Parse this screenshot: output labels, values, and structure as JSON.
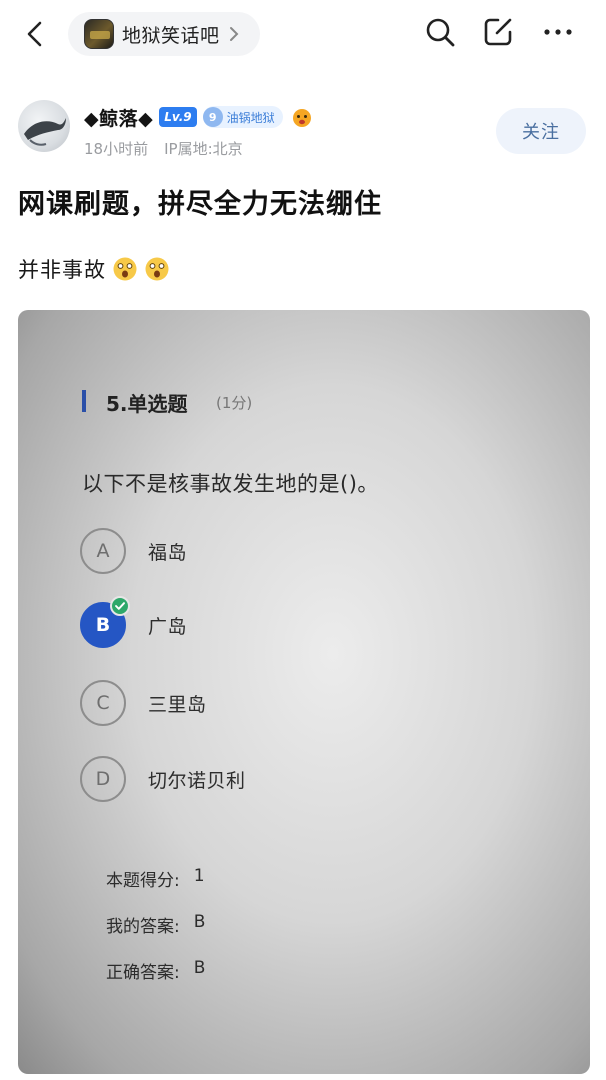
{
  "nav": {
    "forum_name": "地狱笑话吧"
  },
  "post": {
    "author": "◆鲸落◆",
    "level_badge": "Lv.9",
    "fan_level": "9",
    "fan_title": "油锅地狱",
    "time": "18小时前",
    "ip_location": "IP属地:北京",
    "follow_label": "关注",
    "title": "网课刷题，拼尽全力无法绷住",
    "body": "并非事故"
  },
  "quiz": {
    "question_title": "5.单选题",
    "question_score": "(1分)",
    "question_text": "以下不是核事故发生地的是()。",
    "options": [
      {
        "letter": "A",
        "label": "福岛",
        "selected": false
      },
      {
        "letter": "B",
        "label": "广岛",
        "selected": true
      },
      {
        "letter": "C",
        "label": "三里岛",
        "selected": false
      },
      {
        "letter": "D",
        "label": "切尔诺贝利",
        "selected": false
      }
    ],
    "result": {
      "score_label": "本题得分:",
      "score_value": "1",
      "my_answer_label": "我的答案:",
      "my_answer_value": "B",
      "correct_answer_label": "正确答案:",
      "correct_answer_value": "B"
    }
  },
  "colors": {
    "accent_blue": "#2556c4",
    "check_green": "#2ea86a",
    "level_blue": "#2d7df0"
  }
}
